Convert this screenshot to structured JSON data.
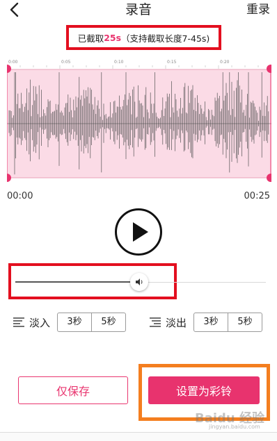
{
  "header": {
    "title": "录音",
    "reset_label": "重录"
  },
  "info": {
    "prefix": "已截取",
    "duration": "25s",
    "suffix": "（支持截取长度7-45s)"
  },
  "waveform": {
    "ticks": [
      "0:00",
      "0:05",
      "0:10",
      "0:15",
      "0:20"
    ],
    "colors": {
      "fill": "#fbdbe6",
      "wave": "#555555",
      "handle": "#e8336e"
    }
  },
  "timeline": {
    "start": "00:00",
    "end": "00:25"
  },
  "volume": {
    "level": 0.48
  },
  "fade_in": {
    "label": "淡入",
    "options": [
      "3秒",
      "5秒"
    ]
  },
  "fade_out": {
    "label": "淡出",
    "options": [
      "3秒",
      "5秒"
    ]
  },
  "actions": {
    "save_label": "仅保存",
    "set_ringtone_label": "设置为彩铃"
  },
  "watermark": {
    "text": "Baidu 经验",
    "sub": "jingyan.baidu.com"
  },
  "colors": {
    "accent": "#e8336e",
    "annotation_red": "#e30f1f",
    "annotation_orange": "#f47e1f"
  }
}
